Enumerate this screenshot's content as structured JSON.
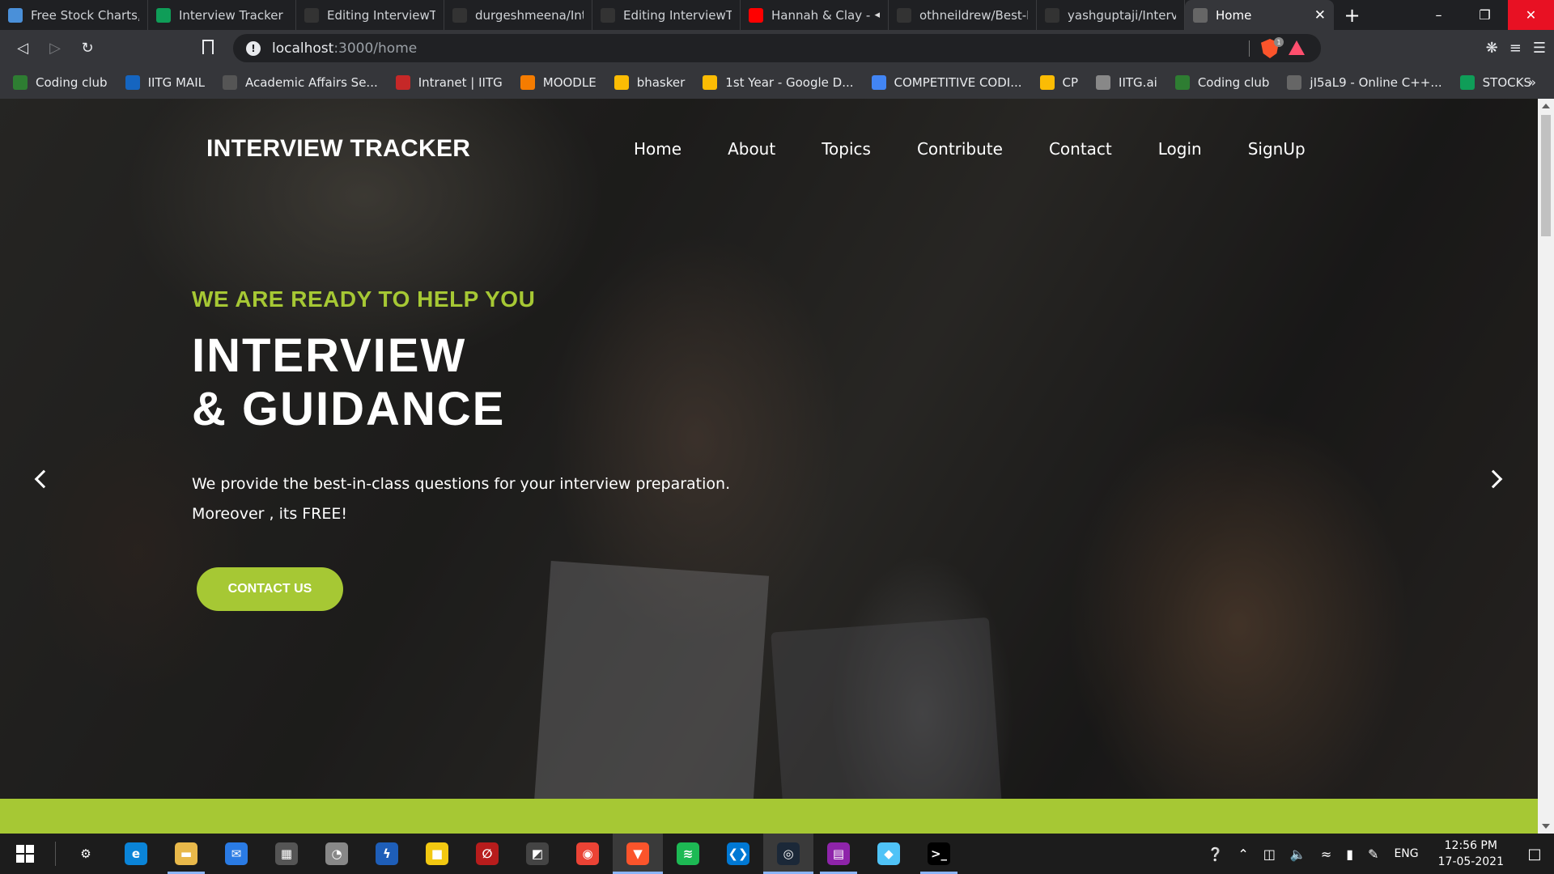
{
  "browser": {
    "tabs": [
      {
        "title": "Free Stock Charts, St",
        "icon": "chart-icon",
        "color": "#4a90d9"
      },
      {
        "title": "Interview Tracker Sul",
        "icon": "sheets-icon",
        "color": "#0f9d58"
      },
      {
        "title": "Editing InterviewTrac",
        "icon": "github-icon",
        "color": "#333333"
      },
      {
        "title": "durgeshmeena/Inter",
        "icon": "github-icon",
        "color": "#333333"
      },
      {
        "title": "Editing InterviewTrac",
        "icon": "github-icon",
        "color": "#333333"
      },
      {
        "title": "Hannah & Clay -",
        "icon": "youtube-icon",
        "color": "#ff0000"
      },
      {
        "title": "othneildrew/Best-RE",
        "icon": "github-icon",
        "color": "#333333"
      },
      {
        "title": "yashguptaji/Intervie",
        "icon": "github-icon",
        "color": "#333333"
      },
      {
        "title": "Home",
        "icon": "globe-icon",
        "color": "#666666"
      }
    ],
    "url_host": "localhost",
    "url_path": ":3000/home",
    "brave_badge": "1",
    "bookmarks": [
      {
        "label": "Coding club",
        "color": "#2e7d32"
      },
      {
        "label": "IITG MAIL",
        "color": "#1565c0"
      },
      {
        "label": "Academic Affairs Se...",
        "color": "#555555"
      },
      {
        "label": "Intranet | IITG",
        "color": "#c62828"
      },
      {
        "label": "MOODLE",
        "color": "#f57c00"
      },
      {
        "label": "bhasker",
        "color": "#fbbc04"
      },
      {
        "label": "1st Year - Google D...",
        "color": "#fbbc04"
      },
      {
        "label": "COMPETITIVE CODI...",
        "color": "#4285f4"
      },
      {
        "label": "CP",
        "color": "#fbbc04"
      },
      {
        "label": "IITG.ai",
        "color": "#888888"
      },
      {
        "label": "Coding club",
        "color": "#2e7d32"
      },
      {
        "label": "jI5aL9 - Online C++...",
        "color": "#666666"
      },
      {
        "label": "STOCKS",
        "color": "#0f9d58"
      }
    ]
  },
  "site": {
    "logo": "INTERVIEW TRACKER",
    "nav": [
      "Home",
      "About",
      "Topics",
      "Contribute",
      "Contact",
      "Login",
      "SignUp"
    ],
    "tagline": "WE ARE READY TO HELP YOU",
    "headline_line1": "INTERVIEW",
    "headline_line2": "& GUIDANCE",
    "desc_line1": "We provide the best-in-class questions for your interview preparation.",
    "desc_line2": "Moreover , its FREE!",
    "cta": "CONTACT US",
    "accent": "#a6c834"
  },
  "taskbar": {
    "apps": [
      {
        "name": "settings-icon",
        "glyph": "⚙",
        "color": "#1c1c1c"
      },
      {
        "name": "edge-icon",
        "glyph": "e",
        "color": "#0a84d8"
      },
      {
        "name": "file-explorer-icon",
        "glyph": "▬",
        "color": "#e8b84a"
      },
      {
        "name": "mail-icon",
        "glyph": "✉",
        "color": "#2a7be4"
      },
      {
        "name": "store-icon",
        "glyph": "▦",
        "color": "#555555"
      },
      {
        "name": "clock-app-icon",
        "glyph": "◔",
        "color": "#888888"
      },
      {
        "name": "app-icon",
        "glyph": "ϟ",
        "color": "#1e5eb8"
      },
      {
        "name": "sticky-notes-icon",
        "glyph": "■",
        "color": "#f2c811"
      },
      {
        "name": "app-red-icon",
        "glyph": "∅",
        "color": "#b71c1c"
      },
      {
        "name": "app-gray-icon",
        "glyph": "◩",
        "color": "#444444"
      },
      {
        "name": "chrome-icon",
        "glyph": "◉",
        "color": "#ea4335"
      },
      {
        "name": "brave-icon",
        "glyph": "▼",
        "color": "#fb542b"
      },
      {
        "name": "spotify-icon",
        "glyph": "≋",
        "color": "#1db954"
      },
      {
        "name": "vscode-icon",
        "glyph": "❮❯",
        "color": "#0078d4"
      },
      {
        "name": "steam-icon",
        "glyph": "◎",
        "color": "#1b2838"
      },
      {
        "name": "winrar-icon",
        "glyph": "▤",
        "color": "#8e24aa"
      },
      {
        "name": "app-blue-icon",
        "glyph": "◆",
        "color": "#4fc3f7"
      },
      {
        "name": "terminal-icon",
        "glyph": ">_",
        "color": "#000000"
      }
    ],
    "language": "ENG",
    "time": "12:56 PM",
    "date": "17-05-2021"
  }
}
